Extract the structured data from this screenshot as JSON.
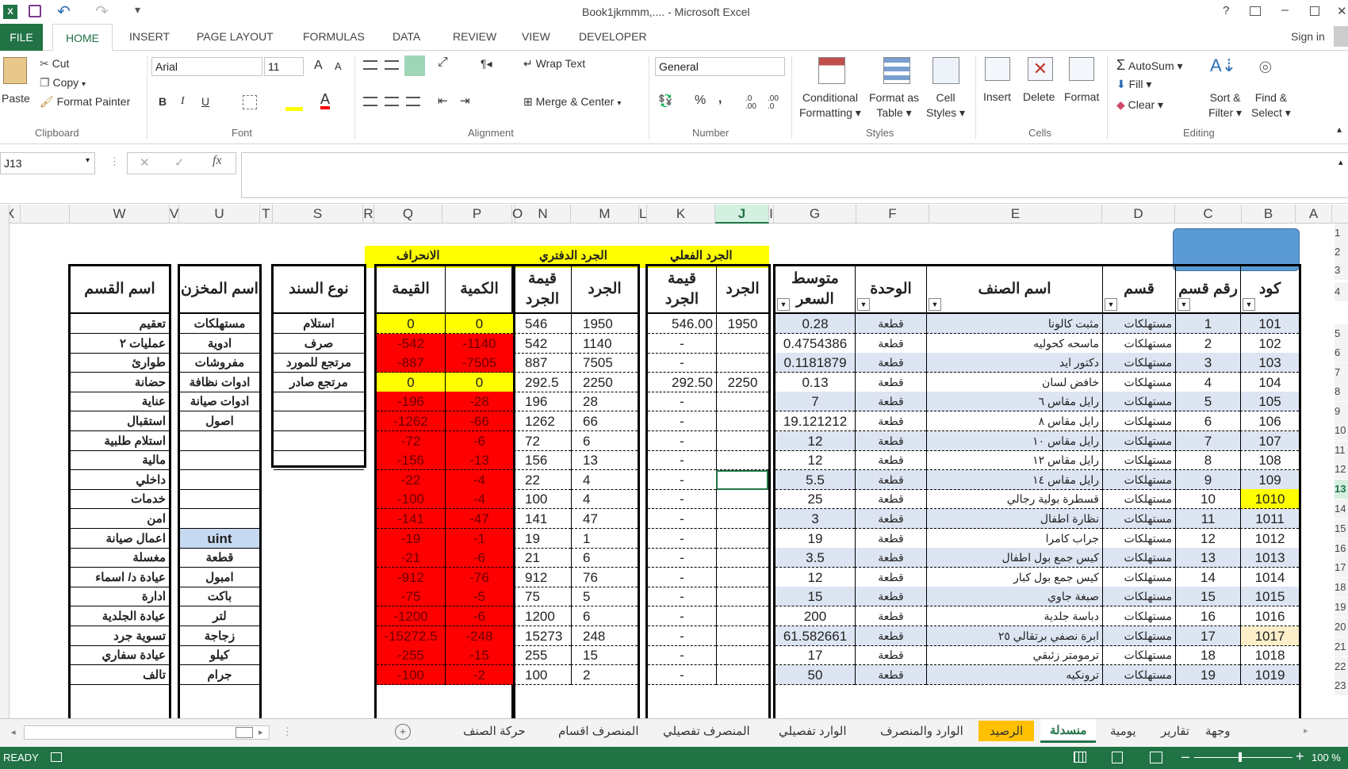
{
  "titlebar": {
    "title": "Book1jkmmm,.... - Microsoft Excel",
    "help": "?",
    "minimize": "–",
    "close": "✕"
  },
  "ribbon_tabs": {
    "file": "FILE",
    "tabs": [
      "HOME",
      "INSERT",
      "PAGE LAYOUT",
      "FORMULAS",
      "DATA",
      "REVIEW",
      "VIEW",
      "DEVELOPER"
    ],
    "sign_in": "Sign in"
  },
  "clipboard": {
    "paste": "Paste",
    "cut": "Cut",
    "copy": "Copy",
    "format_painter": "Format Painter",
    "label": "Clipboard"
  },
  "font": {
    "name": "Arial",
    "size": "11",
    "bold": "B",
    "italic": "I",
    "underline": "U",
    "label": "Font",
    "grow": "A",
    "shrink": "A"
  },
  "alignment": {
    "wrap_text": "Wrap Text",
    "merge_center": "Merge & Center",
    "label": "Alignment"
  },
  "number": {
    "format": "General",
    "percent": "%",
    "comma": ",",
    "label": "Number",
    "inc": ".0 .00",
    "dec": ".00 .0"
  },
  "styles": {
    "conditional": [
      "Conditional",
      "Formatting"
    ],
    "format_table": [
      "Format as",
      "Table"
    ],
    "cell_styles": [
      "Cell",
      "Styles"
    ],
    "label": "Styles"
  },
  "cells": {
    "insert": "Insert",
    "delete": "Delete",
    "format": "Format",
    "label": "Cells"
  },
  "editing": {
    "autosum": "AutoSum",
    "fill": "Fill",
    "clear": "Clear",
    "sort": [
      "Sort &",
      "Filter"
    ],
    "find": [
      "Find &",
      "Select"
    ],
    "label": "Editing"
  },
  "formula_bar": {
    "name_box": "J13",
    "fx": "fx",
    "cancel": "✕",
    "enter": "✓",
    "value": ""
  },
  "columns": [
    "X",
    "W",
    "V",
    "U",
    "T",
    "S",
    "R",
    "Q",
    "P",
    "O",
    "N",
    "M",
    "L",
    "K",
    "J",
    "I",
    "G",
    "F",
    "E",
    "D",
    "C",
    "B",
    "A"
  ],
  "row_numbers": [
    "1",
    "2",
    "3",
    "4",
    "5",
    "6",
    "7",
    "8",
    "9",
    "10",
    "11",
    "12",
    "13",
    "14",
    "15",
    "16",
    "17",
    "18",
    "19",
    "20",
    "21",
    "22",
    "23"
  ],
  "section_labels": {
    "deviation": "الانحراف",
    "book_count": "الجرد الدفتري",
    "actual_count": "الجرد الفعلي"
  },
  "headers": {
    "code": "كود",
    "section_no": "رقم قسم",
    "section": "قسم",
    "item_name": "اسم الصنف",
    "unit": "الوحدة",
    "avg_price": [
      "متوسط",
      "السعر"
    ],
    "actual_qty": "الجرد",
    "actual_value": [
      "قيمة",
      "الجرد"
    ],
    "book_qty": "الجرد",
    "book_value": [
      "قيمة",
      "الجرد"
    ],
    "dev_qty": "الكمية",
    "dev_value": "القيمة",
    "doc_type": "نوع السند",
    "store_name": "اسم المخزن",
    "dept_name": "اسم القسم"
  },
  "items": [
    {
      "code": "101",
      "no": "1",
      "section": "مستهلكات",
      "name": "مثبت كالونا",
      "unit": "قطعة",
      "price": "0.28",
      "actual": "1950",
      "actual_value": "546.00",
      "book": "1950",
      "book_value": "546",
      "dev_qty": "0",
      "dev_value": "0"
    },
    {
      "code": "102",
      "no": "2",
      "section": "مستهلكات",
      "name": "ماسحه كحوليه",
      "unit": "قطعة",
      "price": "0.4754386",
      "actual": "",
      "actual_value": "-",
      "book": "1140",
      "book_value": "542",
      "dev_qty": "-1140",
      "dev_value": "-542"
    },
    {
      "code": "103",
      "no": "3",
      "section": "مستهلكات",
      "name": "دكتور ايد",
      "unit": "قطعة",
      "price": "0.1181879",
      "actual": "",
      "actual_value": "-",
      "book": "7505",
      "book_value": "887",
      "dev_qty": "-7505",
      "dev_value": "-887"
    },
    {
      "code": "104",
      "no": "4",
      "section": "مستهلكات",
      "name": "خافض لسان",
      "unit": "قطعة",
      "price": "0.13",
      "actual": "2250",
      "actual_value": "292.50",
      "book": "2250",
      "book_value": "292.5",
      "dev_qty": "0",
      "dev_value": "0"
    },
    {
      "code": "105",
      "no": "5",
      "section": "مستهلكات",
      "name": "رايل مقاس ٦",
      "unit": "قطعة",
      "price": "7",
      "actual": "",
      "actual_value": "-",
      "book": "28",
      "book_value": "196",
      "dev_qty": "-28",
      "dev_value": "-196"
    },
    {
      "code": "106",
      "no": "6",
      "section": "مستهلكات",
      "name": "رايل مقاس ٨",
      "unit": "قطعة",
      "price": "19.121212",
      "actual": "",
      "actual_value": "-",
      "book": "66",
      "book_value": "1262",
      "dev_qty": "-66",
      "dev_value": "-1262"
    },
    {
      "code": "107",
      "no": "7",
      "section": "مستهلكات",
      "name": "رايل مقاس ١٠",
      "unit": "قطعة",
      "price": "12",
      "actual": "",
      "actual_value": "-",
      "book": "6",
      "book_value": "72",
      "dev_qty": "-6",
      "dev_value": "-72"
    },
    {
      "code": "108",
      "no": "8",
      "section": "مستهلكات",
      "name": "رايل مقاس ١٢",
      "unit": "قطعة",
      "price": "12",
      "actual": "",
      "actual_value": "-",
      "book": "13",
      "book_value": "156",
      "dev_qty": "-13",
      "dev_value": "-156"
    },
    {
      "code": "109",
      "no": "9",
      "section": "مستهلكات",
      "name": "رايل مقاس ١٤",
      "unit": "قطعة",
      "price": "5.5",
      "actual": "",
      "actual_value": "-",
      "book": "4",
      "book_value": "22",
      "dev_qty": "-4",
      "dev_value": "-22"
    },
    {
      "code": "1010",
      "no": "10",
      "section": "مستهلكات",
      "name": "قسطرة بولية رجالي",
      "unit": "قطعة",
      "price": "25",
      "actual": "",
      "actual_value": "-",
      "book": "4",
      "book_value": "100",
      "dev_qty": "-4",
      "dev_value": "-100"
    },
    {
      "code": "1011",
      "no": "11",
      "section": "مستهلكات",
      "name": "نظارة اطفال",
      "unit": "قطعة",
      "price": "3",
      "actual": "",
      "actual_value": "-",
      "book": "47",
      "book_value": "141",
      "dev_qty": "-47",
      "dev_value": "-141"
    },
    {
      "code": "1012",
      "no": "12",
      "section": "مستهلكات",
      "name": "جراب كامرا",
      "unit": "قطعة",
      "price": "19",
      "actual": "",
      "actual_value": "-",
      "book": "1",
      "book_value": "19",
      "dev_qty": "-1",
      "dev_value": "-19"
    },
    {
      "code": "1013",
      "no": "13",
      "section": "مستهلكات",
      "name": "كيس جمع بول اطفال",
      "unit": "قطعة",
      "price": "3.5",
      "actual": "",
      "actual_value": "-",
      "book": "6",
      "book_value": "21",
      "dev_qty": "-6",
      "dev_value": "-21"
    },
    {
      "code": "1014",
      "no": "14",
      "section": "مستهلكات",
      "name": "كيس جمع بول كبار",
      "unit": "قطعة",
      "price": "12",
      "actual": "",
      "actual_value": "-",
      "book": "76",
      "book_value": "912",
      "dev_qty": "-76",
      "dev_value": "-912"
    },
    {
      "code": "1015",
      "no": "15",
      "section": "مستهلكات",
      "name": "صبغة جاوي",
      "unit": "قطعة",
      "price": "15",
      "actual": "",
      "actual_value": "-",
      "book": "5",
      "book_value": "75",
      "dev_qty": "-5",
      "dev_value": "-75"
    },
    {
      "code": "1016",
      "no": "16",
      "section": "مستهلكات",
      "name": "دباسة جلدية",
      "unit": "قطعة",
      "price": "200",
      "actual": "",
      "actual_value": "-",
      "book": "6",
      "book_value": "1200",
      "dev_qty": "-6",
      "dev_value": "-1200"
    },
    {
      "code": "1017",
      "no": "17",
      "section": "مستهلكات",
      "name": "ابرة نصفي برتقالي ٢٥",
      "unit": "قطعة",
      "price": "61.582661",
      "actual": "",
      "actual_value": "-",
      "book": "248",
      "book_value": "15273",
      "dev_qty": "-248",
      "dev_value": "-15272.5"
    },
    {
      "code": "1018",
      "no": "18",
      "section": "مستهلكات",
      "name": "ترمومتر زئبقي",
      "unit": "قطعة",
      "price": "17",
      "actual": "",
      "actual_value": "-",
      "book": "15",
      "book_value": "255",
      "dev_qty": "-15",
      "dev_value": "-255"
    },
    {
      "code": "1019",
      "no": "19",
      "section": "مستهلكات",
      "name": "ترونكيه",
      "unit": "قطعة",
      "price": "50",
      "actual": "",
      "actual_value": "-",
      "book": "2",
      "book_value": "100",
      "dev_qty": "-2",
      "dev_value": "-100"
    }
  ],
  "doc_types": [
    "استلام",
    "صرف",
    "مرتجع للمورد",
    "مرتجع صادر"
  ],
  "stores": [
    "مستهلكات",
    "ادوية",
    "مفروشات",
    "ادوات نظافة",
    "ادوات صيانة",
    "اصول",
    "",
    "",
    "",
    "",
    "",
    "uint",
    "قطعة",
    "امبول",
    "باكت",
    "لتر",
    "زجاجة",
    "كيلو",
    "جرام"
  ],
  "departments": [
    "تعقيم",
    "عمليات ٢",
    "طوارئ",
    "حضانة",
    "عناية",
    "استقبال",
    "استلام طلبية",
    "مالية",
    "داخلي",
    "خدمات",
    "امن",
    "اعمال صيانة",
    "مغسلة",
    "عيادة د/ اسماء",
    "ادارة",
    "عيادة الجلدية",
    "تسوية جرد",
    "عيادة سفاري",
    "تالف"
  ],
  "sheet_tabs": [
    "وجهة",
    "تقارير",
    "يومية",
    "منسدلة",
    "الرصيد",
    "الوارد والمنصرف",
    "الوارد تفصيلي",
    "المنصرف تفصيلي",
    "المنصرف اقسام",
    "حركة الصنف"
  ],
  "status": {
    "ready": "READY",
    "zoom": "100 %"
  },
  "colors": {
    "excel_green": "#217346",
    "yellow": "#ffff00",
    "red": "#ff0000",
    "light_blue": "#dde4f2",
    "shape_blue": "#5b9bd5"
  }
}
